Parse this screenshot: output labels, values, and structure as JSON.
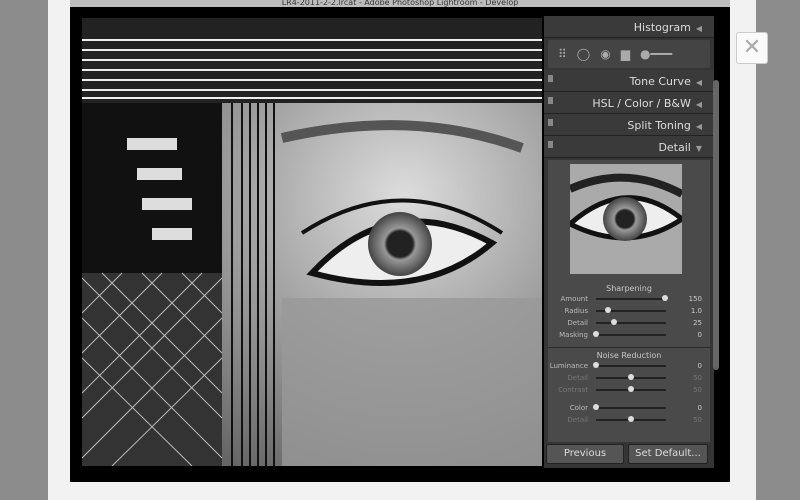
{
  "window": {
    "title": "LR4-2011-2-2.lrcat - Adobe Photoshop Lightroom - Develop"
  },
  "close_label": "✕",
  "panels": {
    "histogram": "Histogram",
    "tone_curve": "Tone Curve",
    "hsl": "HSL  /  Color  /  B&W",
    "split_toning": "Split Toning",
    "detail": "Detail"
  },
  "sharpening": {
    "title": "Sharpening",
    "sliders": [
      {
        "label": "Amount",
        "value": "150",
        "fraction": 0.99
      },
      {
        "label": "Radius",
        "value": "1.0",
        "fraction": 0.17
      },
      {
        "label": "Detail",
        "value": "25",
        "fraction": 0.25
      },
      {
        "label": "Masking",
        "value": "0",
        "fraction": 0
      }
    ]
  },
  "noise_reduction": {
    "title": "Noise Reduction",
    "sliders": [
      {
        "label": "Luminance",
        "value": "0",
        "fraction": 0,
        "dim": false
      },
      {
        "label": "Detail",
        "value": "50",
        "fraction": 0.5,
        "dim": true
      },
      {
        "label": "Contrast",
        "value": "50",
        "fraction": 0.5,
        "dim": true
      },
      {
        "label": "Color",
        "value": "0",
        "fraction": 0,
        "dim": false
      },
      {
        "label": "Detail",
        "value": "50",
        "fraction": 0.5,
        "dim": true
      }
    ]
  },
  "buttons": {
    "previous": "Previous",
    "set_default": "Set Default..."
  }
}
